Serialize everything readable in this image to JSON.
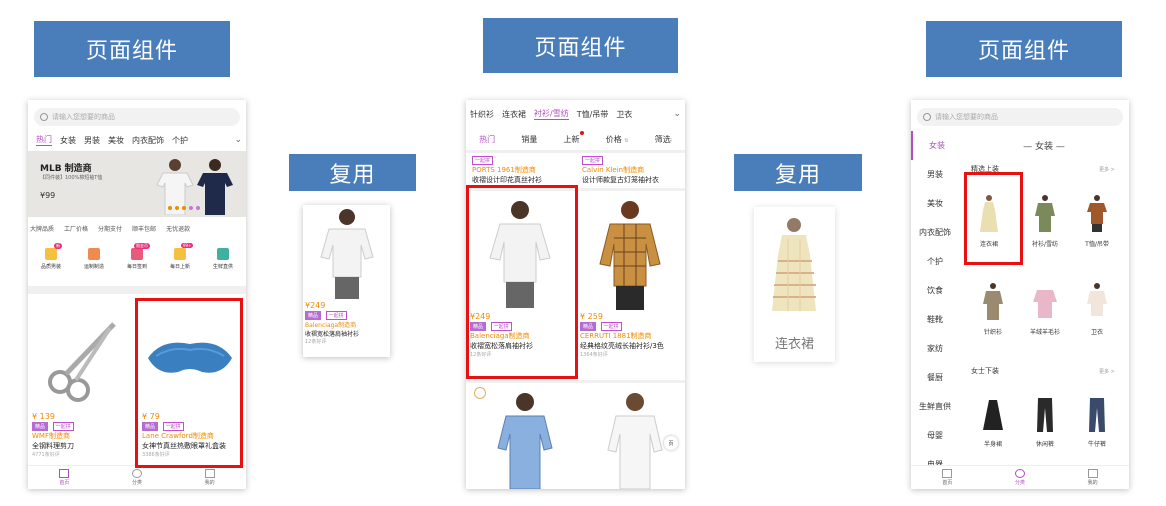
{
  "labels": {
    "page_component": "页面组件",
    "reuse": "复用"
  },
  "phone1": {
    "search_placeholder": "请输入您想要的商品",
    "tabs": [
      "热门",
      "女装",
      "男装",
      "美妆",
      "内衣配饰",
      "个护"
    ],
    "banner_title": "MLB 制造商",
    "banner_sub": "【同件装】100%棉短袖T恤",
    "banner_price": "¥99",
    "features": [
      "大牌品质",
      "工厂价格",
      "分期支付",
      "顺丰包邮",
      "无忧退款"
    ],
    "icons": [
      {
        "label": "品质男装",
        "badge": "新"
      },
      {
        "label": "运制制造",
        "badge": ""
      },
      {
        "label": "每日签到",
        "badge": "限金币"
      },
      {
        "label": "每日上新",
        "badge": "99+"
      },
      {
        "label": "生鲜直供",
        "badge": ""
      }
    ],
    "products": [
      {
        "price": "¥ 139",
        "tag1": "精品",
        "tag2": "一起拼",
        "brand": "WMF制造商",
        "name": "全钢料理剪刀",
        "note": "4771条好评"
      },
      {
        "price": "¥ 79",
        "tag1": "精品",
        "tag2": "一起拼",
        "brand": "Lane Crawford制造商",
        "name": "女神节真丝热敷眼罩礼盒装",
        "note": "3386条好评"
      }
    ],
    "nav": [
      "首页",
      "分类",
      "我的"
    ]
  },
  "reuse_card1": {
    "price": "¥249",
    "tag1": "精品",
    "tag2": "一起拼",
    "brand": "Balenciaga制造商",
    "name": "收褶宽松落肩袖衬衫",
    "note": "12条好评"
  },
  "phone2": {
    "top_tabs": [
      "针织衫",
      "连衣裙",
      "衬衫/雪纺",
      "T恤/吊带",
      "卫衣"
    ],
    "sort_tabs": [
      "热门",
      "销量",
      "上新",
      "价格",
      "筛选"
    ],
    "top_products": [
      {
        "tag": "一起拼",
        "brand": "PORTS 1961制造商",
        "name": "收褶设计印花真丝衬衫"
      },
      {
        "tag": "一起拼",
        "brand": "Calvin Klein制造商",
        "name": "设计师款复古灯笼袖衬衣"
      }
    ],
    "products": [
      {
        "price": "¥249",
        "tag1": "精品",
        "tag2": "一起拼",
        "brand": "Balenciaga制造商",
        "name": "收褶宽松落肩袖衬衫",
        "note": "12条好评"
      },
      {
        "price": "¥ 259",
        "tag1": "精品",
        "tag2": "一起拼",
        "brand": "CERRUTI 1881制造商",
        "name": "经典格纹亮绒长袖衬衫/3色",
        "note": "1364条好评"
      }
    ],
    "float_button": "页"
  },
  "reuse_card2": {
    "label": "连衣裙"
  },
  "phone3": {
    "search_placeholder": "请输入您想要的商品",
    "sidebar": [
      "女装",
      "男装",
      "美妆",
      "内衣配饰",
      "个护",
      "饮食",
      "鞋靴",
      "家纺",
      "餐厨",
      "生鲜直供",
      "母婴",
      "电器"
    ],
    "section_title": "— 女装 —",
    "group1_title": "精选上装",
    "group1_more": "更多 >",
    "group1_items": [
      "连衣裙",
      "衬衫/雪纺",
      "T恤/吊带",
      "针织衫",
      "羊绒羊毛衫",
      "卫衣"
    ],
    "group2_title": "女士下装",
    "group2_more": "更多 >",
    "group2_items": [
      "半身裙",
      "休闲裤",
      "牛仔裤"
    ],
    "nav": [
      "首页",
      "分类",
      "我的"
    ]
  },
  "colors": {
    "label_blue": "#4a7ebb",
    "highlight_red": "#e81010",
    "accent_purple": "#b04fc0",
    "price_orange": "#f08a00"
  }
}
